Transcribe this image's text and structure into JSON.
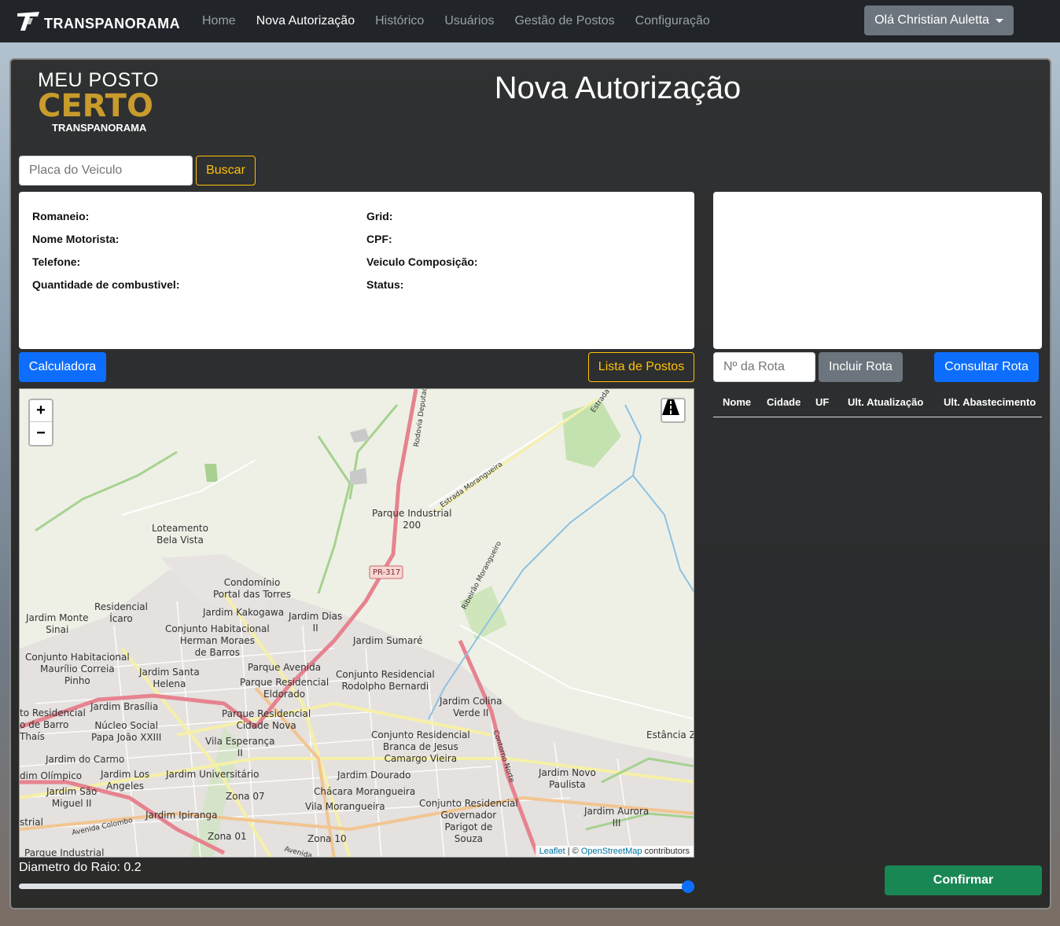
{
  "navbar": {
    "brand": "TRANSPANORAMA",
    "links": [
      {
        "label": "Home",
        "active": false
      },
      {
        "label": "Nova Autorização",
        "active": true
      },
      {
        "label": "Histórico",
        "active": false
      },
      {
        "label": "Usuários",
        "active": false
      },
      {
        "label": "Gestão de Postos",
        "active": false
      },
      {
        "label": "Configuração",
        "active": false
      }
    ],
    "user_menu": "Olá Christian Auletta"
  },
  "logo": {
    "line1": "MEU POSTO",
    "line2": "CERTO",
    "line3": "TRANSPANORAMA"
  },
  "page_title": "Nova Autorização",
  "search": {
    "placeholder": "Placa do Veiculo",
    "button": "Buscar"
  },
  "info": {
    "romaneio": "Romaneio:",
    "grid": "Grid:",
    "motorista": "Nome Motorista:",
    "cpf": "CPF:",
    "telefone": "Telefone:",
    "veiculo": "Veiculo Composição:",
    "combustivel": "Quantidade de combustivel:",
    "status": "Status:"
  },
  "buttons": {
    "calculadora": "Calculadora",
    "lista_postos": "Lista de Postos",
    "incluir_rota": "Incluir Rota",
    "consultar_rota": "Consultar Rota",
    "confirmar": "Confirmar"
  },
  "route": {
    "placeholder": "Nº da Rota"
  },
  "table": {
    "columns": [
      "Nome",
      "Cidade",
      "UF",
      "Ult. Atualização",
      "Ult. Abastecimento"
    ]
  },
  "map": {
    "zoom_in": "+",
    "zoom_out": "−",
    "attribution_leaflet": "Leaflet",
    "attribution_sep": " | © ",
    "attribution_osm": "OpenStreetMap",
    "attribution_suffix": " contributors",
    "labels": [
      "Loteamento\nBela Vista",
      "Parque Industrial\n200",
      "PR-317",
      "Condomínio\nPortal das Torres",
      "Residencial\nÍcaro",
      "Jardim Kakogawa",
      "Jardim Monte\nSinai",
      "Jardim Dias\nII",
      "Conjunto Habitacional\nHerman Moraes\nde Barros",
      "Jardim Sumaré",
      "Conjunto Habitacional\nMaurílio Correia\nPinho",
      "Jardim Santa\nHelena",
      "Parque Avenida",
      "Parque Residencial\nEldorado",
      "Conjunto Residencial\nRodolpho Bernardi",
      "Jardim Brasília",
      "Jardim Colina\nVerde II",
      "Parque Residencial\nCidade Nova",
      "Núcleo Social\nPapa João XXIII",
      "Vila Esperança\nII",
      "Conjunto Residencial\nBranca de Jesus\nCamargo Vieira",
      "Estância Za",
      "Jardim do Carmo",
      "Jardim Los\nAngeles",
      "Jardim Universitário",
      "Jardim Dourado",
      "Jardim Novo\nPaulista",
      "Jardim São\nMiguel II",
      "Zona 07",
      "Chácara Morangueira",
      "Vila Morangueira",
      "Conjunto Residencial\nGovernador\nParigot de\nSouza",
      "Jardim Aurora\nIII",
      "Jardim Ipiranga",
      "Zona 01",
      "Zona 10",
      "dim Olímpico",
      "to Residencial\no de Barro\nThaís",
      "strial",
      "Parque Industrial",
      "Estrada Morangueira",
      "Ribeirão Morangueiro",
      "Rodovia Deputado",
      "Contorno Norte",
      "Avenida Colombo",
      "Avenida",
      "Estrada"
    ]
  },
  "radius": {
    "label": "Diametro do Raio: 0.2",
    "value": 1.0
  }
}
